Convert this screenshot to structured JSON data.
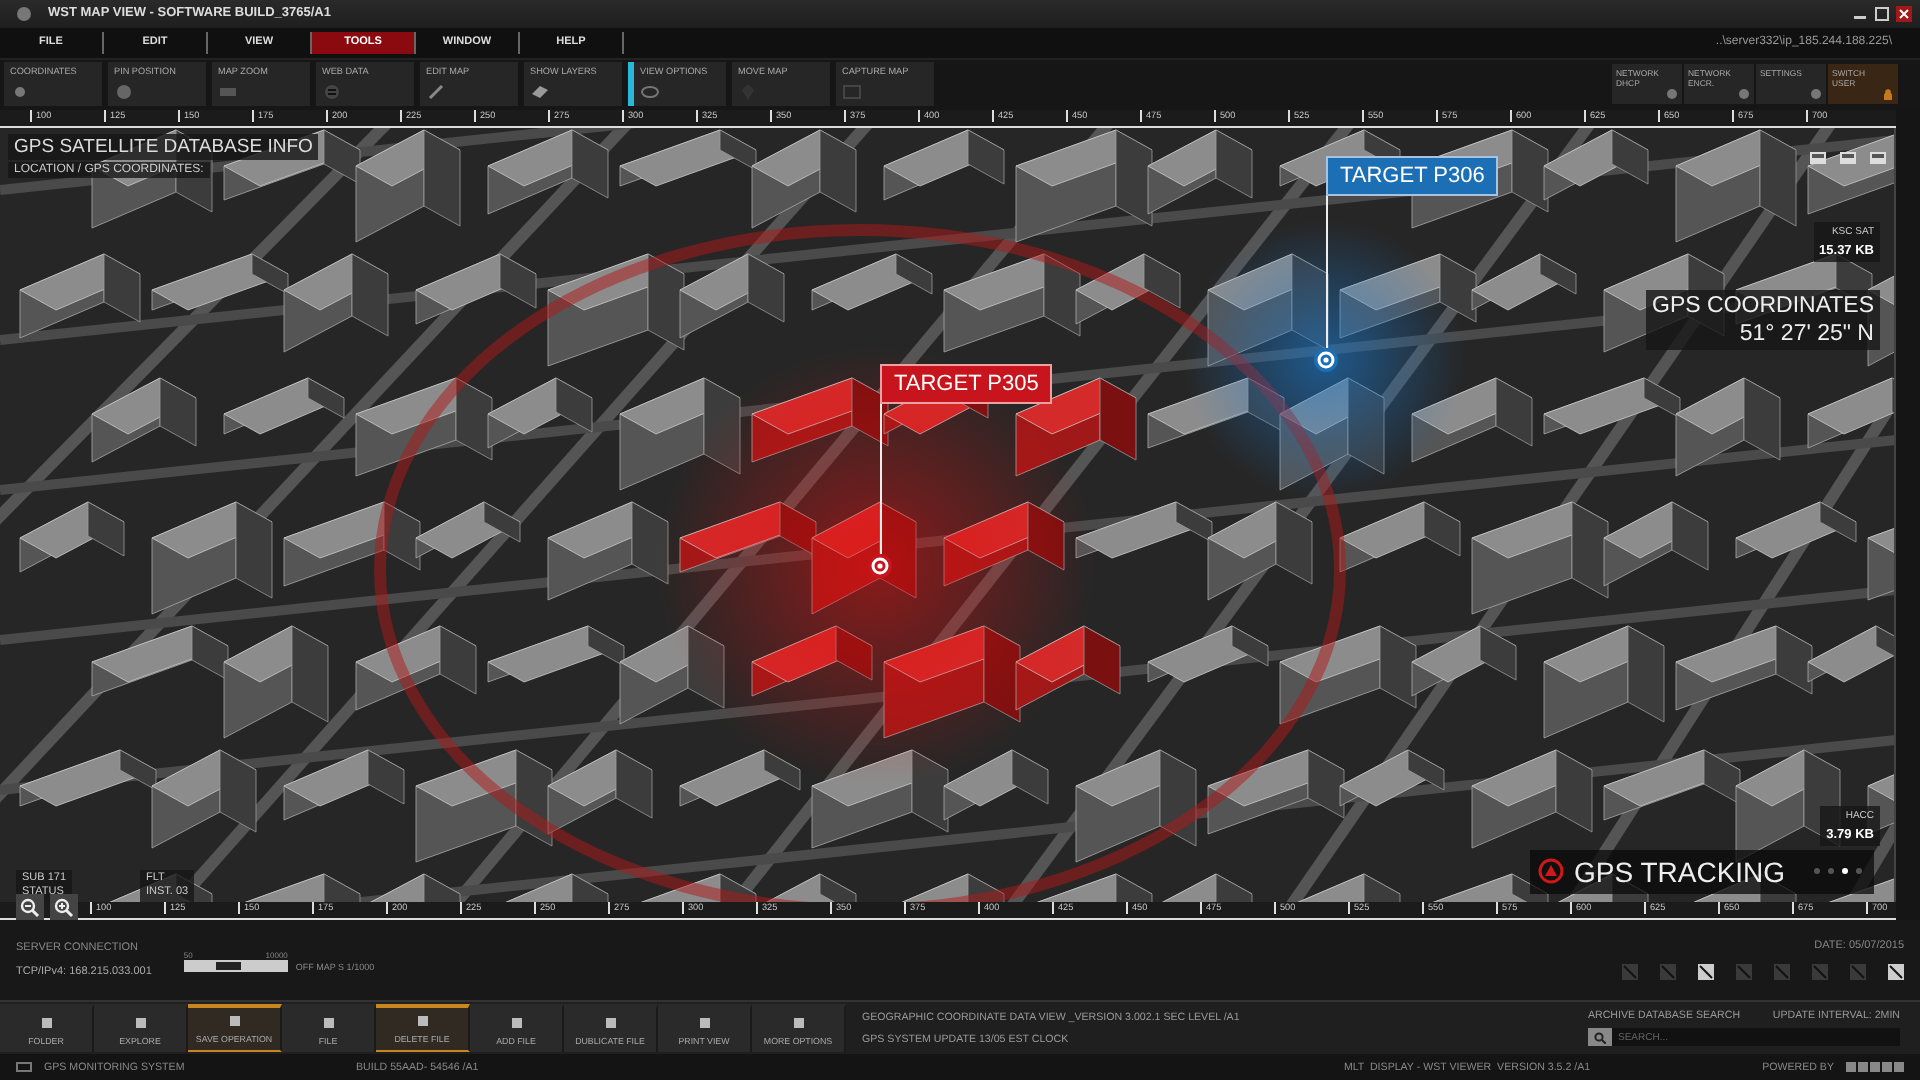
{
  "window": {
    "title": "WST MAP VIEW - SOFTWARE BUILD_3765/A1"
  },
  "menu": {
    "items": [
      {
        "label": "FILE",
        "selected": false
      },
      {
        "label": "EDIT",
        "selected": false
      },
      {
        "label": "VIEW",
        "selected": false
      },
      {
        "label": "TOOLS",
        "selected": true
      },
      {
        "label": "WINDOW",
        "selected": false
      },
      {
        "label": "HELP",
        "selected": false
      }
    ],
    "server_path": "..\\server332\\ip_185.244.188.225\\"
  },
  "toolbar": {
    "items": [
      {
        "label": "COORDINATES",
        "selected": false
      },
      {
        "label": "PIN POSITION",
        "selected": false
      },
      {
        "label": "MAP ZOOM",
        "selected": false
      },
      {
        "label": "WEB DATA",
        "selected": false
      },
      {
        "label": "EDIT MAP",
        "selected": false
      },
      {
        "label": "SHOW LAYERS",
        "selected": false
      },
      {
        "label": "VIEW OPTIONS",
        "selected": true
      },
      {
        "label": "MOVE MAP",
        "selected": false
      },
      {
        "label": "CAPTURE MAP",
        "selected": false
      }
    ]
  },
  "quick_settings": [
    {
      "label": "NETWORK DHCP",
      "selected": false
    },
    {
      "label": "NETWORK ENCR.",
      "selected": false
    },
    {
      "label": "SETTINGS",
      "selected": false
    },
    {
      "label": "SWITCH USER",
      "selected": true
    }
  ],
  "map": {
    "top_ruler": [
      "100",
      "125",
      "150",
      "175",
      "200",
      "225",
      "250",
      "275",
      "300",
      "325",
      "350",
      "375",
      "400",
      "425",
      "450",
      "475",
      "500",
      "525",
      "550",
      "575",
      "600",
      "625",
      "650",
      "675",
      "700"
    ],
    "bottom_ruler": [
      "100",
      "125",
      "150",
      "175",
      "200",
      "225",
      "250",
      "275",
      "300",
      "325",
      "350",
      "375",
      "400",
      "425",
      "450",
      "475",
      "500",
      "525",
      "550",
      "575",
      "600",
      "625",
      "650",
      "675",
      "700"
    ],
    "info_title": "GPS SATELLITE DATABASE INFO",
    "info_subtitle": "LOCATION / GPS COORDINATES:",
    "targets": [
      {
        "label": "TARGET P306",
        "color": "#1c6fb4"
      },
      {
        "label": "TARGET P305",
        "color": "#c8141c"
      }
    ],
    "readouts": [
      {
        "label": "KSC SAT",
        "value": "15.37 KB"
      },
      {
        "label": "HACC",
        "value": "3.79 KB"
      },
      {
        "label": "SUB 171",
        "value": "STATUS"
      },
      {
        "label": "FLT",
        "value": "INST. 03"
      }
    ],
    "coordinates": {
      "label": "GPS COORDINATES",
      "value": "51° 27' 25\" N"
    },
    "tracking": {
      "label": "GPS TRACKING",
      "pages": [
        {
          "selected": false
        },
        {
          "selected": false
        },
        {
          "selected": true
        },
        {
          "selected": false
        }
      ]
    }
  },
  "info_strip": {
    "server_label": "SERVER CONNECTION",
    "server_address": "TCP/IPv4: 168.215.033.001",
    "scale_min": "50",
    "scale_max": "10000",
    "scale_label": "OFF MAP S 1/1000",
    "date": "DATE: 05/07/2015",
    "view_toggles": [
      {
        "on": false
      },
      {
        "on": false
      },
      {
        "on": true
      },
      {
        "on": false
      },
      {
        "on": false
      },
      {
        "on": false
      },
      {
        "on": false
      },
      {
        "on": true
      }
    ]
  },
  "actions": [
    {
      "label": "FOLDER",
      "selected": false
    },
    {
      "label": "EXPLORE",
      "selected": false
    },
    {
      "label": "SAVE OPERATION",
      "selected": true
    },
    {
      "label": "FILE",
      "selected": false
    },
    {
      "label": "DELETE FILE",
      "selected": true
    },
    {
      "label": "ADD FILE",
      "selected": false
    },
    {
      "label": "DUBLICATE FILE",
      "selected": false
    },
    {
      "label": "PRINT VIEW",
      "selected": false
    },
    {
      "label": "MORE OPTIONS",
      "selected": false
    }
  ],
  "system_info": [
    "GEOGRAPHIC COORDINATE DATA VIEW _VERSION 3.002.1 SEC LEVEL /A1",
    "GPS SYSTEM UPDATE 13/05 EST CLOCK"
  ],
  "archive": {
    "label": "ARCHIVE DATABASE SEARCH",
    "interval": "UPDATE INTERVAL: 2MIN",
    "placeholder": "SEARCH..."
  },
  "status_bar": {
    "system": "GPS MONITORING SYSTEM",
    "build": "BUILD 55AAD- 54546 /A1",
    "display": "MLT  DISPLAY - WST VIEWER  VERSION 3.5.2 /A1",
    "powered": "POWERED BY"
  }
}
